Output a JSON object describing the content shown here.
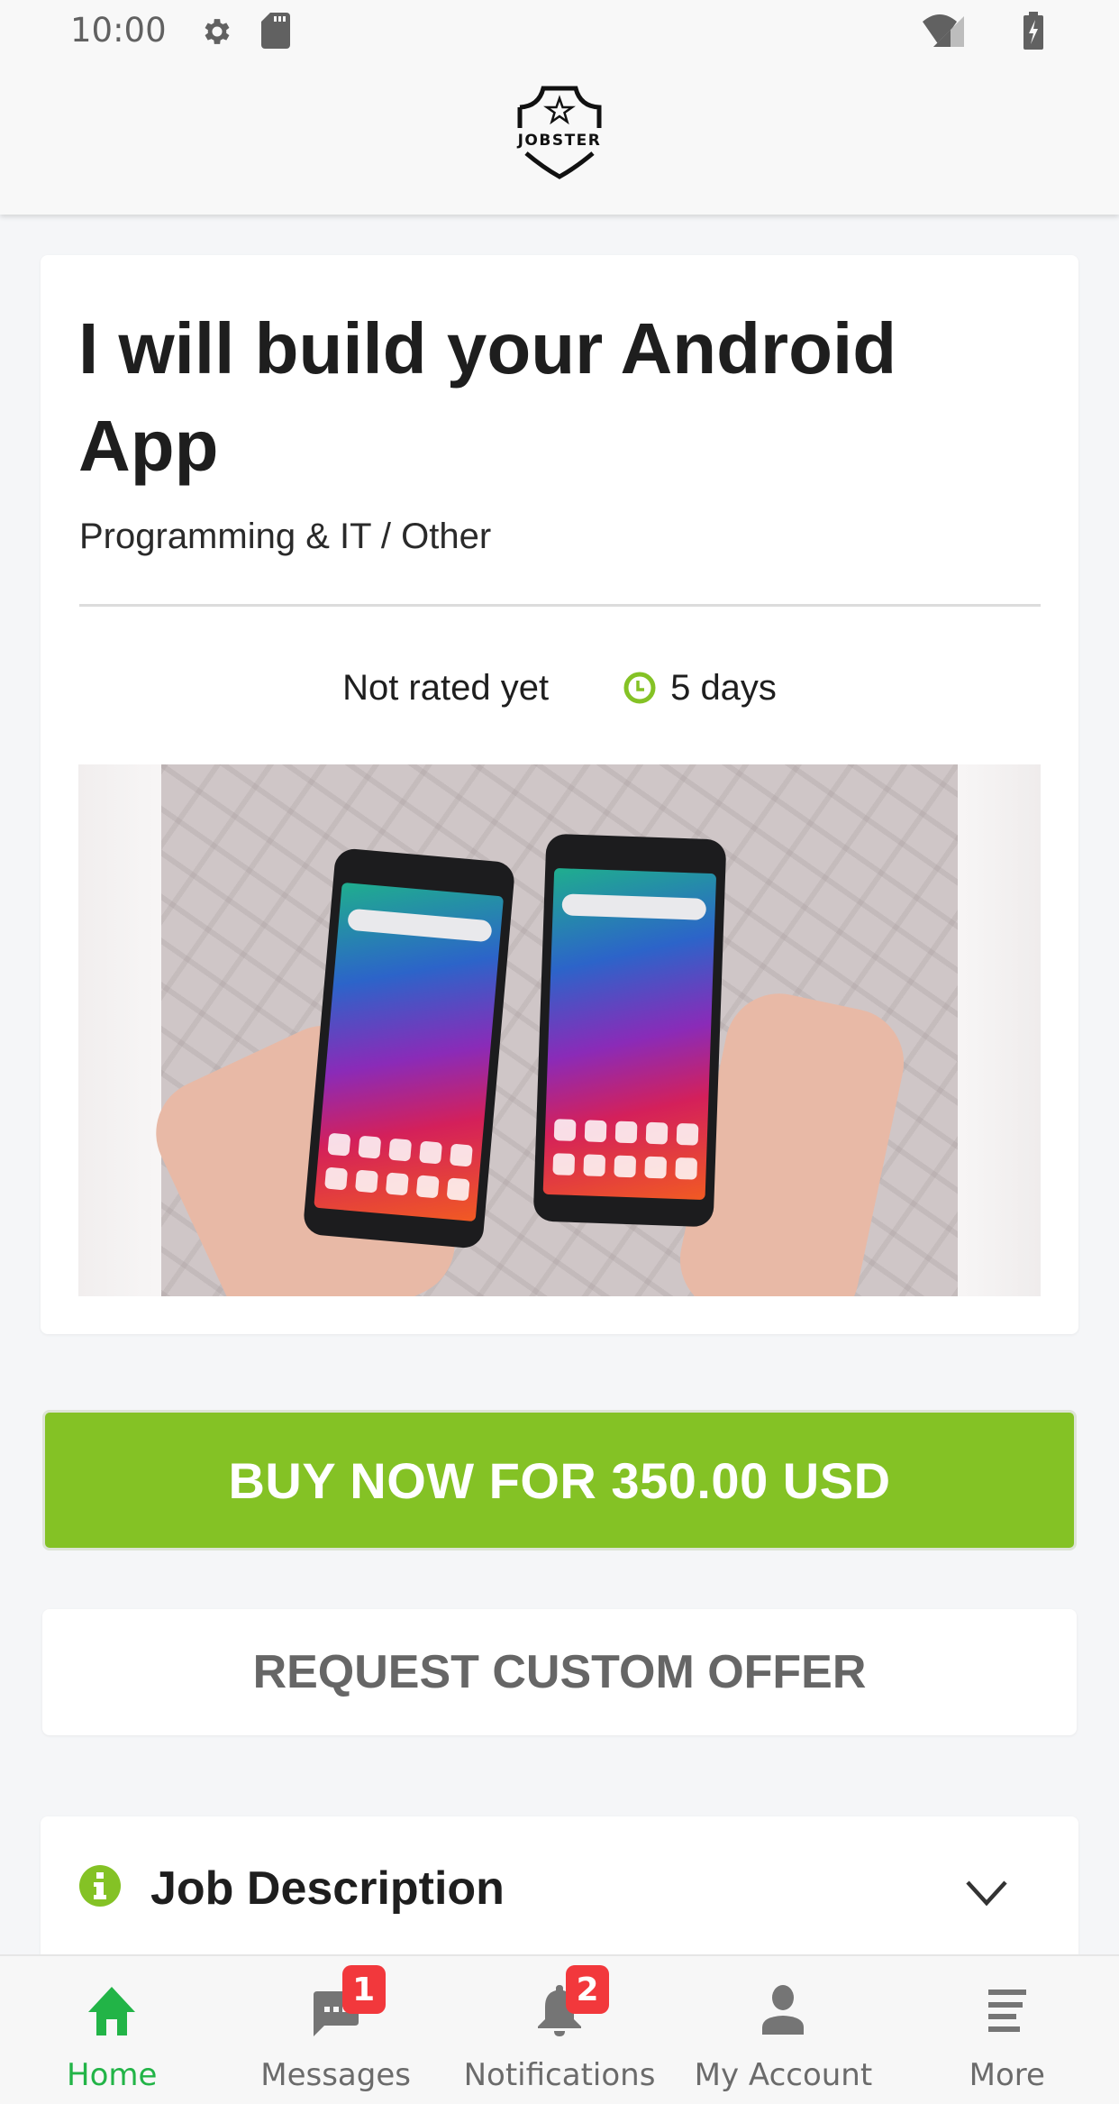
{
  "status_bar": {
    "time": "10:00",
    "left_icons": [
      "settings-icon",
      "sd-card-icon"
    ],
    "right_icons": [
      "wifi-icon",
      "cell-signal-icon",
      "battery-charging-icon"
    ]
  },
  "header": {
    "logo_text": "JOBSTER"
  },
  "job": {
    "title": "I will build your Android App",
    "category": "Programming & IT / Other",
    "rating_text": "Not rated yet",
    "delivery_time": "5 days",
    "image_alt": "Two hands holding Android smartphones"
  },
  "actions": {
    "buy_label": "BUY NOW FOR 350.00 USD",
    "request_label": "REQUEST CUSTOM OFFER"
  },
  "colors": {
    "accent_green": "#84c225",
    "nav_active": "#22b447",
    "badge_red": "#f2383c"
  },
  "sections": {
    "job_description": "Job Description"
  },
  "bottom_nav": {
    "items": [
      {
        "label": "Home",
        "icon": "home-icon",
        "active": true
      },
      {
        "label": "Messages",
        "icon": "chat-icon",
        "badge": "1"
      },
      {
        "label": "Notifications",
        "icon": "bell-icon",
        "badge": "2"
      },
      {
        "label": "My Account",
        "icon": "person-icon"
      },
      {
        "label": "More",
        "icon": "menu-icon"
      }
    ]
  }
}
